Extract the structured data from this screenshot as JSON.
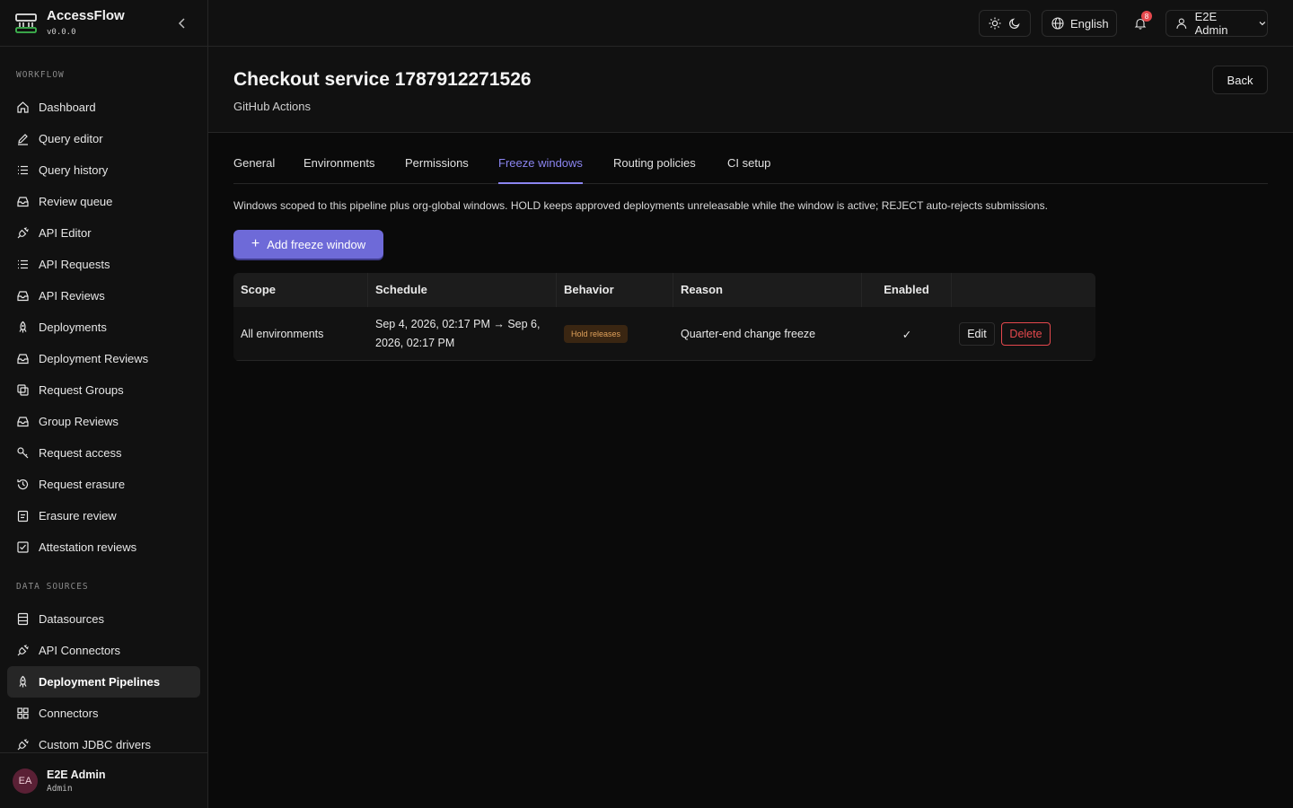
{
  "brand": {
    "name": "AccessFlow",
    "version": "v0.0.0"
  },
  "sidebar": {
    "workflow_label": "WORKFLOW",
    "workflow_items": [
      {
        "label": "Dashboard",
        "icon": "home-icon"
      },
      {
        "label": "Query editor",
        "icon": "pencil-icon"
      },
      {
        "label": "Query history",
        "icon": "list-icon"
      },
      {
        "label": "Review queue",
        "icon": "inbox-icon"
      },
      {
        "label": "API Editor",
        "icon": "plug-icon"
      },
      {
        "label": "API Requests",
        "icon": "list-icon"
      },
      {
        "label": "API Reviews",
        "icon": "inbox-icon"
      },
      {
        "label": "Deployments",
        "icon": "rocket-icon"
      },
      {
        "label": "Deployment Reviews",
        "icon": "inbox-icon"
      },
      {
        "label": "Request Groups",
        "icon": "copy-icon"
      },
      {
        "label": "Group Reviews",
        "icon": "inbox-icon"
      },
      {
        "label": "Request access",
        "icon": "key-icon"
      },
      {
        "label": "Request erasure",
        "icon": "history-icon"
      },
      {
        "label": "Erasure review",
        "icon": "clipboard-icon"
      },
      {
        "label": "Attestation reviews",
        "icon": "checkbox-icon"
      }
    ],
    "datasources_label": "DATA SOURCES",
    "datasource_items": [
      {
        "label": "Datasources",
        "icon": "database-icon"
      },
      {
        "label": "API Connectors",
        "icon": "plug-icon"
      },
      {
        "label": "Deployment Pipelines",
        "icon": "rocket-icon",
        "active": true
      },
      {
        "label": "Connectors",
        "icon": "grid-icon"
      },
      {
        "label": "Custom JDBC drivers",
        "icon": "plug-icon"
      }
    ],
    "user": {
      "initials": "EA",
      "name": "E2E Admin",
      "role": "Admin"
    }
  },
  "topbar": {
    "language": "English",
    "notification_count": "8",
    "user_name": "E2E Admin"
  },
  "page": {
    "title": "Checkout service 1787912271526",
    "subtitle": "GitHub Actions",
    "back_label": "Back"
  },
  "tabs": [
    "General",
    "Environments",
    "Permissions",
    "Freeze windows",
    "Routing policies",
    "CI setup"
  ],
  "active_tab": "Freeze windows",
  "description": "Windows scoped to this pipeline plus org-global windows. HOLD keeps approved deployments unreleasable while the window is active; REJECT auto-rejects submissions.",
  "add_button": "Add freeze window",
  "table": {
    "headers": [
      "Scope",
      "Schedule",
      "Behavior",
      "Reason",
      "Enabled"
    ],
    "rows": [
      {
        "scope": "All environments",
        "schedule_line1": "Sep 4, 2026, 02:17 PM → Sep 6,",
        "schedule_line2": "2026, 02:17 PM",
        "behavior": "Hold releases",
        "reason": "Quarter-end change freeze",
        "enabled": "✓",
        "edit": "Edit",
        "delete": "Delete"
      }
    ]
  },
  "colors": {
    "accent": "#8b85f0",
    "primary_button": "#6e6ad8",
    "danger": "#e5484d",
    "badge_text": "#e0a15a",
    "badge_bg": "#3a2612"
  }
}
